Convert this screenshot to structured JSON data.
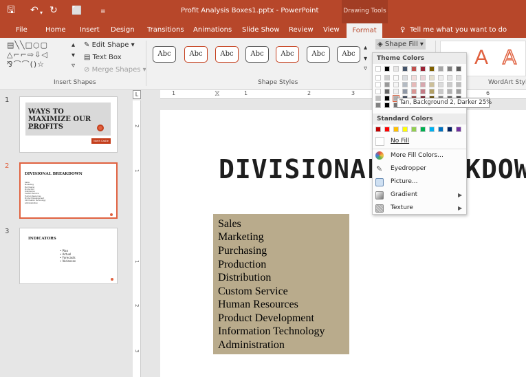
{
  "window": {
    "title": "Profit Analysis Boxes1.pptx - PowerPoint",
    "context_group": "Drawing Tools"
  },
  "qat": {
    "save_icon": "save-icon",
    "undo_icon": "undo-icon",
    "redo_icon": "redo-icon",
    "present_icon": "present-icon",
    "customize_icon": "customize-icon"
  },
  "tabs": [
    "File",
    "Home",
    "Insert",
    "Design",
    "Transitions",
    "Animations",
    "Slide Show",
    "Review",
    "View",
    "Format"
  ],
  "tell_me": "Tell me what you want to do",
  "ribbon": {
    "edit_shape": "Edit Shape",
    "text_box": "Text Box",
    "merge_shapes": "Merge Shapes",
    "insert_shapes_label": "Insert Shapes",
    "shape_styles_label": "Shape Styles",
    "wordart_label": "WordArt Style",
    "shape_fill": "Shape Fill",
    "abc": [
      "Abc",
      "Abc",
      "Abc",
      "Abc",
      "Abc",
      "Abc",
      "Abc"
    ],
    "wordart_letter": "A"
  },
  "fill_menu": {
    "theme_colors_label": "Theme Colors",
    "standard_colors_label": "Standard Colors",
    "no_fill": "No Fill",
    "items": [
      "More Fill Colors...",
      "Eyedropper",
      "Picture...",
      "Gradient",
      "Texture"
    ],
    "tooltip": "Tan, Background 2, Darker 25%",
    "theme_top": [
      "#ffffff",
      "#000000",
      "#e7e6e6",
      "#44546a",
      "#c0504d",
      "#9b2335",
      "#7f6000",
      "#a5a5a5",
      "#7f7f7f",
      "#595959"
    ],
    "standard": [
      "#c00000",
      "#ff0000",
      "#ffc000",
      "#ffff00",
      "#92d050",
      "#00b050",
      "#00b0f0",
      "#0070c0",
      "#002060",
      "#7030a0"
    ]
  },
  "ruler": {
    "h": [
      "1",
      "1",
      "2",
      "3",
      "6"
    ],
    "v": [
      "2",
      "1",
      "1",
      "2",
      "3"
    ]
  },
  "slides": [
    {
      "num": "1",
      "title": "WAYS TO MAXIMIZE OUR PROFITS",
      "subtitle": "Profit Analysis",
      "badge": "North Castle"
    },
    {
      "num": "2",
      "title": "DIVISIONAL BREAKDOWN",
      "bullets": [
        "Sales",
        "Marketing",
        "Purchasing",
        "Production",
        "Distribution",
        "Custom Service",
        "Human Resources",
        "Product Development",
        "Information Technology",
        "Administration"
      ]
    },
    {
      "num": "3",
      "title": "INDICATORS",
      "bullets": [
        "• Plan",
        "• Actual",
        "• Forecasts",
        "• Variances"
      ]
    }
  ],
  "slide": {
    "title": "DIVISIONAL BREAKDOWN",
    "list": [
      "Sales",
      "Marketing",
      "Purchasing",
      "Production",
      "Distribution",
      "Custom Service",
      "Human Resources",
      "Product Development",
      "Information Technology",
      "Administration"
    ]
  }
}
